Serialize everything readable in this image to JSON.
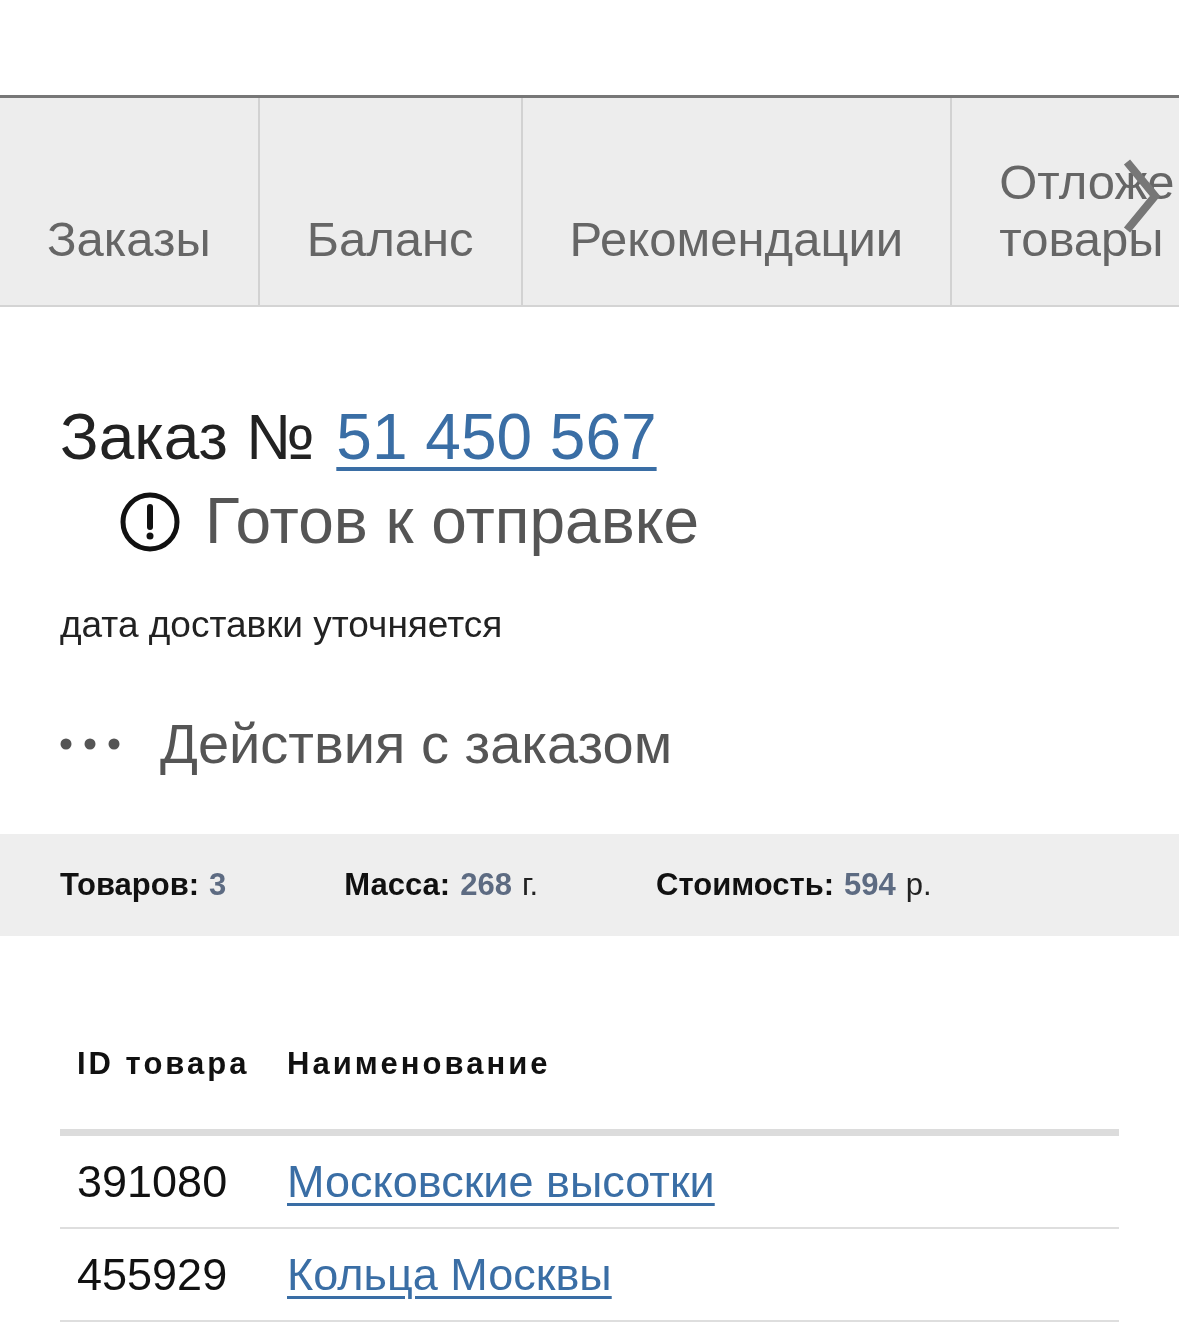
{
  "tabs": [
    {
      "label": "Заказы",
      "selected": false
    },
    {
      "label": "Баланс",
      "selected": false
    },
    {
      "label": "Рекомендации",
      "selected": false
    },
    {
      "label": "Отложе товары",
      "selected": false
    }
  ],
  "order": {
    "title": "Заказ №",
    "number": "51 450 567",
    "status": "Готов к отправке",
    "delivery_note": "дата доставки уточняется",
    "actions_label": "Действия с заказом"
  },
  "summary": [
    {
      "label": "Товаров:",
      "value": "3"
    },
    {
      "label": "Масса:",
      "value": "268",
      "unit": "г."
    },
    {
      "label": "Стоимость:",
      "value": "594",
      "unit": "р."
    }
  ],
  "table": {
    "columns": [
      "ID товара",
      "Наименование"
    ],
    "rows": [
      {
        "id": "391080",
        "name": "Московские высотки"
      },
      {
        "id": "455929",
        "name": "Кольца Москвы"
      }
    ]
  }
}
